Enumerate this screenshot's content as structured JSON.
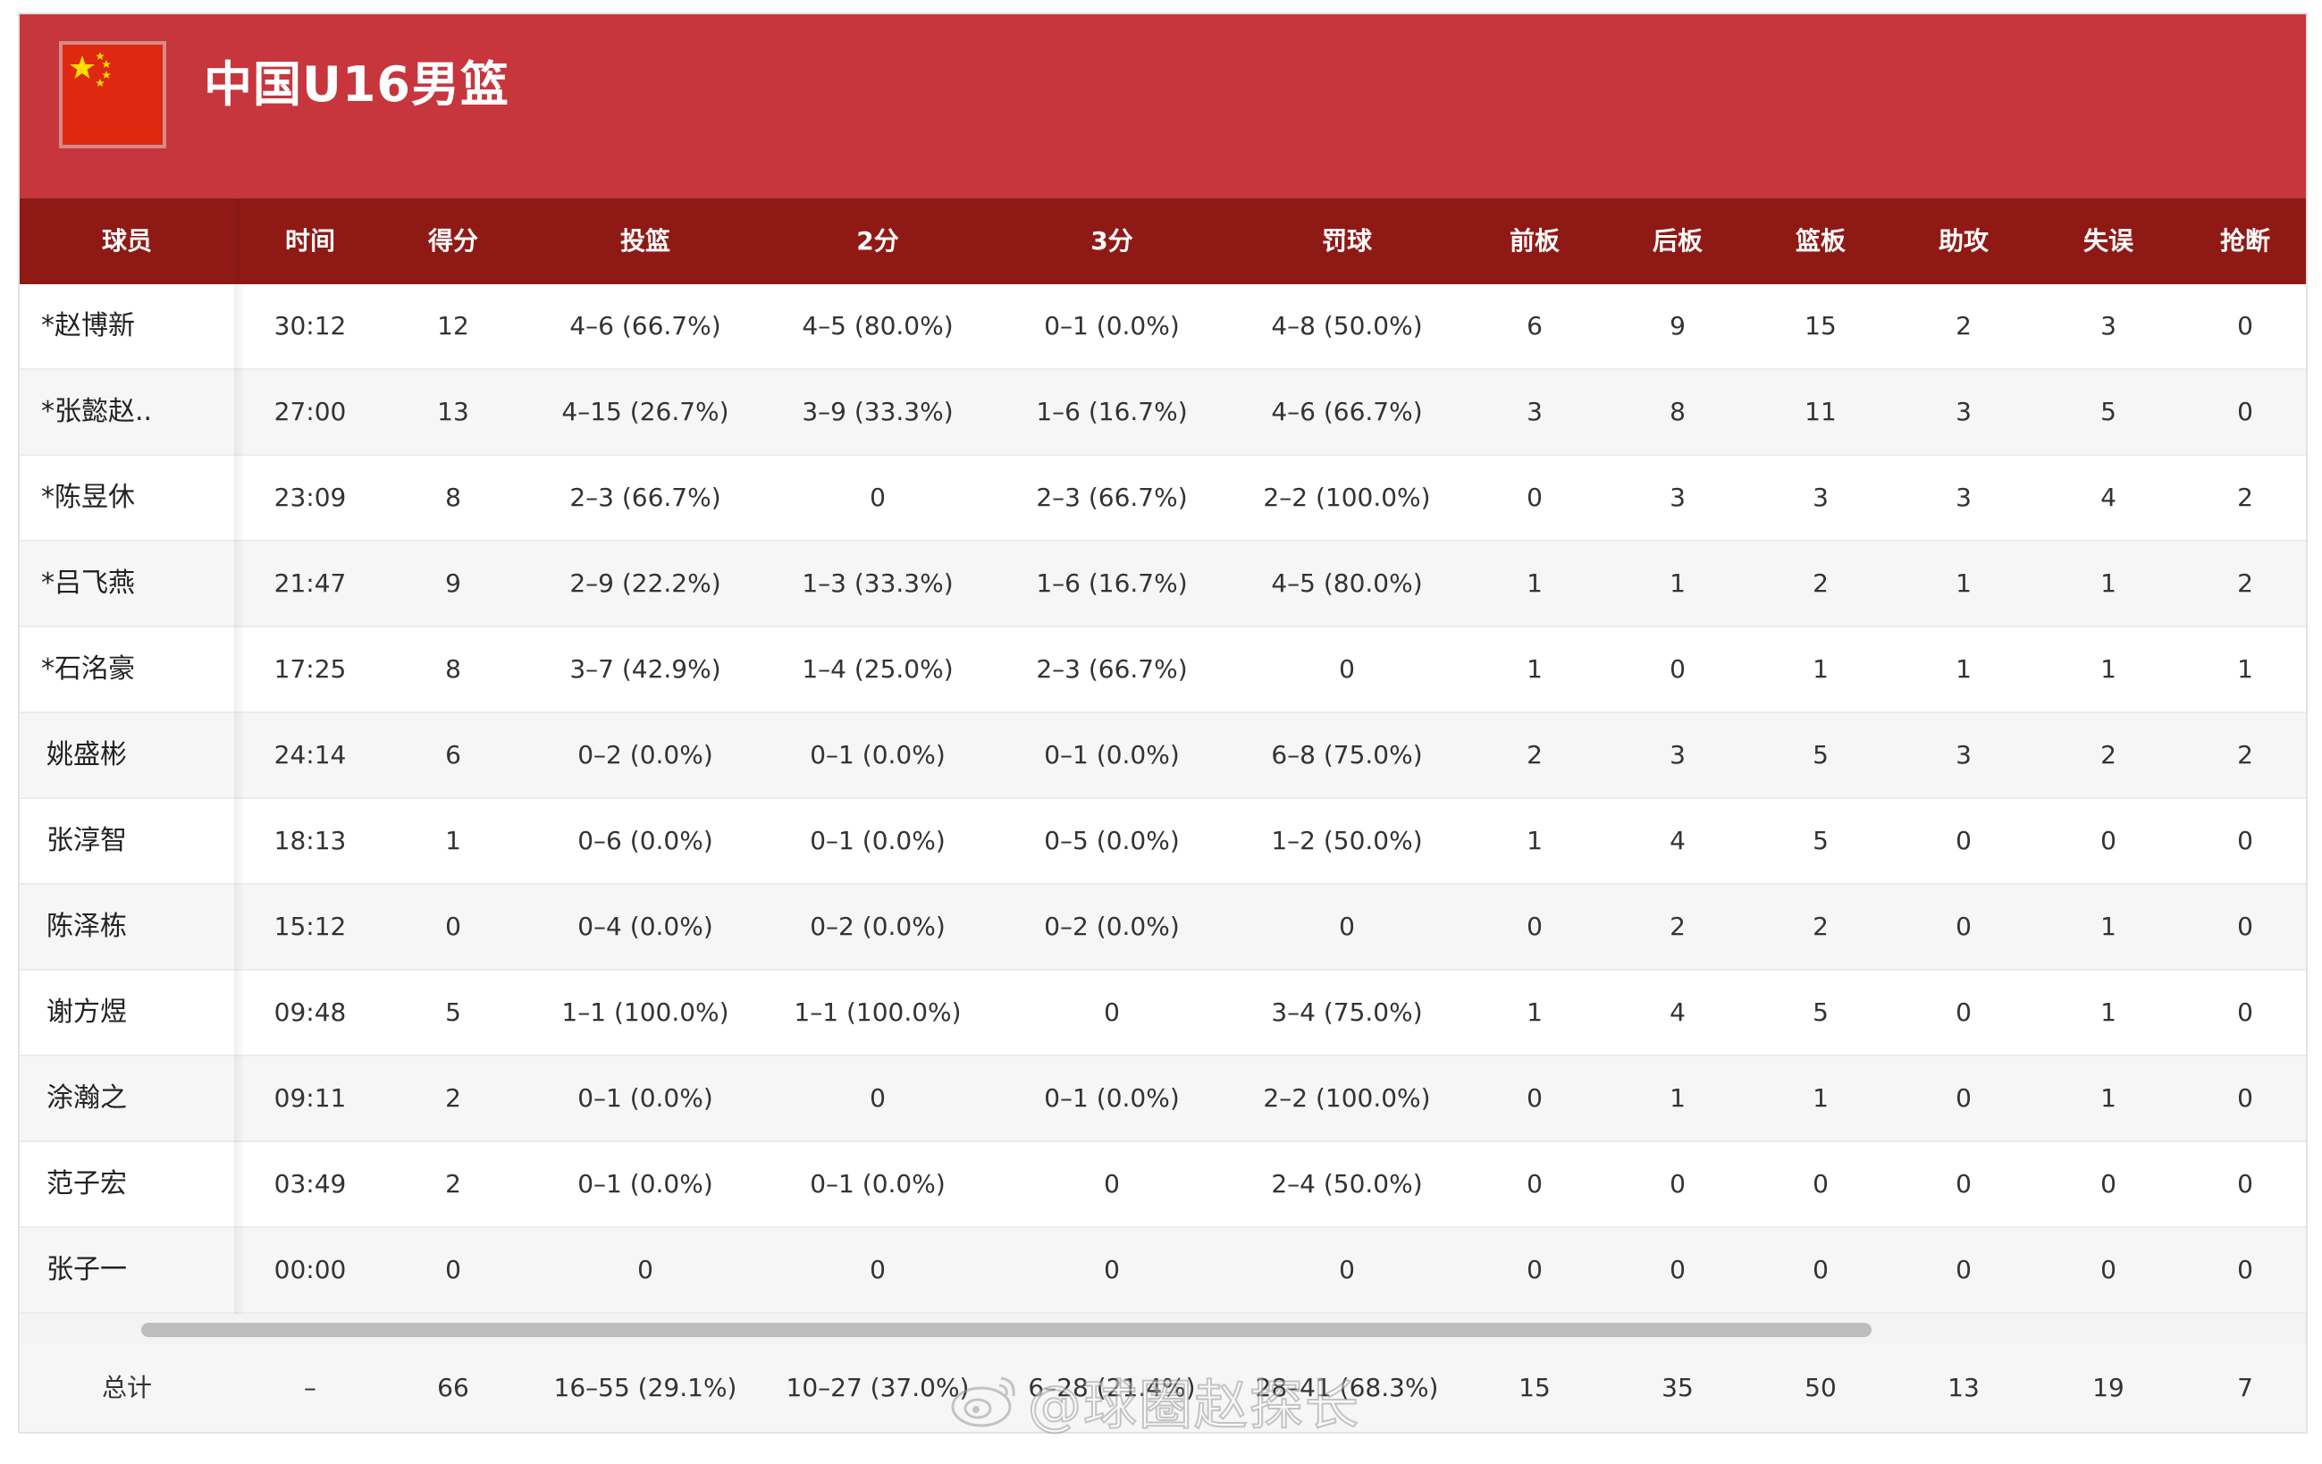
{
  "team": {
    "name": "中国U16男篮",
    "flag_icon": "china-flag-icon"
  },
  "columns": [
    "球员",
    "时间",
    "得分",
    "投篮",
    "2分",
    "3分",
    "罚球",
    "前板",
    "后板",
    "篮板",
    "助攻",
    "失误",
    "抢断"
  ],
  "players": [
    {
      "name": "*赵博新",
      "time": "30:12",
      "pts": "12",
      "fg": "4–6 (66.7%)",
      "two": "4–5 (80.0%)",
      "three": "0–1 (0.0%)",
      "ft": "4–8 (50.0%)",
      "oreb": "6",
      "dreb": "9",
      "reb": "15",
      "ast": "2",
      "tov": "3",
      "stl": "0"
    },
    {
      "name": "*张懿赵..",
      "time": "27:00",
      "pts": "13",
      "fg": "4–15 (26.7%)",
      "two": "3–9 (33.3%)",
      "three": "1–6 (16.7%)",
      "ft": "4–6 (66.7%)",
      "oreb": "3",
      "dreb": "8",
      "reb": "11",
      "ast": "3",
      "tov": "5",
      "stl": "0"
    },
    {
      "name": "*陈昱休",
      "time": "23:09",
      "pts": "8",
      "fg": "2–3 (66.7%)",
      "two": "0",
      "three": "2–3 (66.7%)",
      "ft": "2–2 (100.0%)",
      "oreb": "0",
      "dreb": "3",
      "reb": "3",
      "ast": "3",
      "tov": "4",
      "stl": "2"
    },
    {
      "name": "*吕飞燕",
      "time": "21:47",
      "pts": "9",
      "fg": "2–9 (22.2%)",
      "two": "1–3 (33.3%)",
      "three": "1–6 (16.7%)",
      "ft": "4–5 (80.0%)",
      "oreb": "1",
      "dreb": "1",
      "reb": "2",
      "ast": "1",
      "tov": "1",
      "stl": "2"
    },
    {
      "name": "*石洺豪",
      "time": "17:25",
      "pts": "8",
      "fg": "3–7 (42.9%)",
      "two": "1–4 (25.0%)",
      "three": "2–3 (66.7%)",
      "ft": "0",
      "oreb": "1",
      "dreb": "0",
      "reb": "1",
      "ast": "1",
      "tov": "1",
      "stl": "1"
    },
    {
      "name": "姚盛彬",
      "time": "24:14",
      "pts": "6",
      "fg": "0–2 (0.0%)",
      "two": "0–1 (0.0%)",
      "three": "0–1 (0.0%)",
      "ft": "6–8 (75.0%)",
      "oreb": "2",
      "dreb": "3",
      "reb": "5",
      "ast": "3",
      "tov": "2",
      "stl": "2"
    },
    {
      "name": "张淳智",
      "time": "18:13",
      "pts": "1",
      "fg": "0–6 (0.0%)",
      "two": "0–1 (0.0%)",
      "three": "0–5 (0.0%)",
      "ft": "1–2 (50.0%)",
      "oreb": "1",
      "dreb": "4",
      "reb": "5",
      "ast": "0",
      "tov": "0",
      "stl": "0"
    },
    {
      "name": "陈泽栋",
      "time": "15:12",
      "pts": "0",
      "fg": "0–4 (0.0%)",
      "two": "0–2 (0.0%)",
      "three": "0–2 (0.0%)",
      "ft": "0",
      "oreb": "0",
      "dreb": "2",
      "reb": "2",
      "ast": "0",
      "tov": "1",
      "stl": "0"
    },
    {
      "name": "谢方煜",
      "time": "09:48",
      "pts": "5",
      "fg": "1–1 (100.0%)",
      "two": "1–1 (100.0%)",
      "three": "0",
      "ft": "3–4 (75.0%)",
      "oreb": "1",
      "dreb": "4",
      "reb": "5",
      "ast": "0",
      "tov": "1",
      "stl": "0"
    },
    {
      "name": "涂瀚之",
      "time": "09:11",
      "pts": "2",
      "fg": "0–1 (0.0%)",
      "two": "0",
      "three": "0–1 (0.0%)",
      "ft": "2–2 (100.0%)",
      "oreb": "0",
      "dreb": "1",
      "reb": "1",
      "ast": "0",
      "tov": "1",
      "stl": "0"
    },
    {
      "name": "范子宏",
      "time": "03:49",
      "pts": "2",
      "fg": "0–1 (0.0%)",
      "two": "0–1 (0.0%)",
      "three": "0",
      "ft": "2–4 (50.0%)",
      "oreb": "0",
      "dreb": "0",
      "reb": "0",
      "ast": "0",
      "tov": "0",
      "stl": "0"
    },
    {
      "name": "张子一",
      "time": "00:00",
      "pts": "0",
      "fg": "0",
      "two": "0",
      "three": "0",
      "ft": "0",
      "oreb": "0",
      "dreb": "0",
      "reb": "0",
      "ast": "0",
      "tov": "0",
      "stl": "0"
    }
  ],
  "totals": {
    "name": "总计",
    "time": "–",
    "pts": "66",
    "fg": "16–55 (29.1%)",
    "two": "10–27 (37.0%)",
    "three": "6–28 (21.4%)",
    "ft": "28–41 (68.3%)",
    "oreb": "15",
    "dreb": "35",
    "reb": "50",
    "ast": "13",
    "tov": "19",
    "stl": "7"
  },
  "watermark": {
    "text": "@球圈赵探长",
    "icon": "weibo-logo-icon"
  },
  "colors": {
    "header_red": "#c7363d",
    "column_header_dark_red": "#8f1a15",
    "alt_row": "#f6f6f6"
  }
}
